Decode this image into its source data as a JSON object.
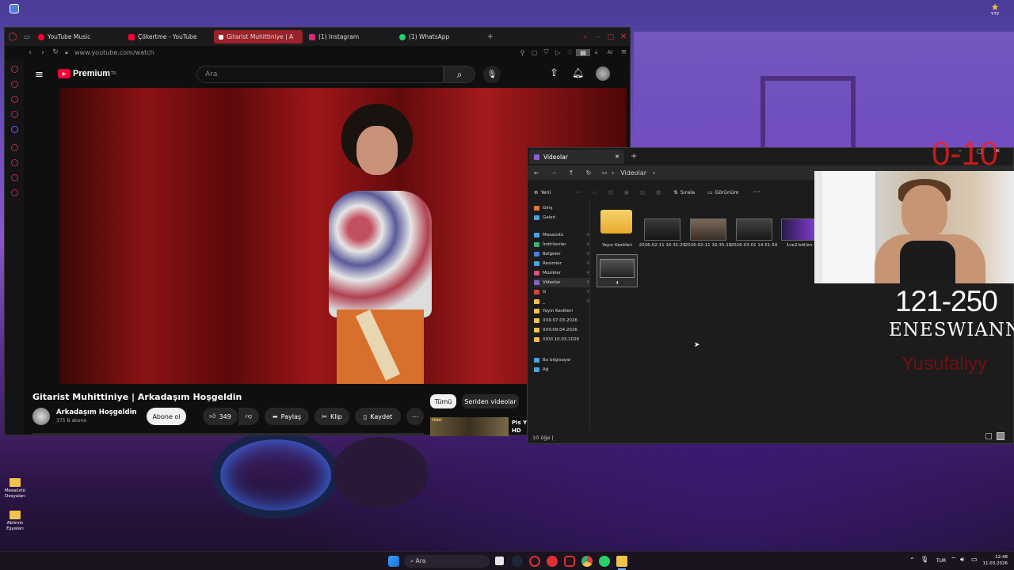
{
  "desktop": {
    "top_left_icon": "app-icon",
    "top_right_label": "Y-TV",
    "icons": [
      {
        "label": "Masaüstü Dosyaları"
      },
      {
        "label": "Ablimin Eşyaları"
      }
    ]
  },
  "browser": {
    "tabs": [
      {
        "label": "YouTube Music",
        "color": "#ff0033"
      },
      {
        "label": "Çökertme - YouTube",
        "color": "#ff0033"
      },
      {
        "label": "Gitarist Muhittiniye | A",
        "color": "#ffffff",
        "active": true
      },
      {
        "label": "(1) Instagram",
        "color": "#d62976"
      },
      {
        "label": "(1) WhatsApp",
        "color": "#25d366"
      }
    ],
    "url": "www.youtube.com/watch",
    "ai_label": "AI"
  },
  "youtube": {
    "logo_text": "Premium",
    "region": "TR",
    "search_placeholder": "Ara",
    "video_title": "Gitarist Muhittiniye | Arkadaşım Hoşgeldin",
    "channel_name": "Arkadaşım Hoşgeldin",
    "subscribers": "375 B abone",
    "subscribe_label": "Abone ol",
    "likes": "349",
    "share_label": "Paylaş",
    "clip_label": "Klip",
    "save_label": "Kaydet",
    "chips": [
      "Tümü",
      "Seriden videolar"
    ],
    "rec_title": "Pis Y HD",
    "rec_badge": "YERLİ"
  },
  "explorer": {
    "tab_title": "Videolar",
    "breadcrumb": "Videolar",
    "new_label": "Yeni",
    "sort_label": "Sırala",
    "view_label": "Görünüm",
    "sidebar": [
      {
        "label": "Giriş",
        "color": "#e07a3a"
      },
      {
        "label": "Galeri",
        "color": "#4aa3df"
      },
      {
        "label": "Masaüstü",
        "color": "#4aa3df"
      },
      {
        "label": "İndirilenler",
        "color": "#3bb273"
      },
      {
        "label": "Belgeler",
        "color": "#4a7fdf"
      },
      {
        "label": "Resimler",
        "color": "#4aa3df"
      },
      {
        "label": "Müzikler",
        "color": "#e0507a"
      },
      {
        "label": "Videolar",
        "color": "#8a5fd0"
      },
      {
        "label": "G",
        "color": "#e04040"
      },
      {
        "label": "_",
        "color": "#f2c14e"
      },
      {
        "label": "Yayın Kesitleri",
        "color": "#f2c14e"
      },
      {
        "label": "XXII.07.03.2026",
        "color": "#f2c14e"
      },
      {
        "label": "XXV.09.04.2026",
        "color": "#f2c14e"
      },
      {
        "label": "XXVI.10.03.2026",
        "color": "#f2c14e"
      },
      {
        "label": "Bu bilgisayar",
        "color": "#4aa3df"
      },
      {
        "label": "Ağ",
        "color": "#4aa3df"
      }
    ],
    "items": [
      {
        "label": "Yayın Kesitleri"
      },
      {
        "label": "2026-02-11 16-31-29"
      },
      {
        "label": "2026-02-11 16-35-18"
      },
      {
        "label": "2026-03-01 14-51-50"
      },
      {
        "label": "1ve2.bölüm"
      },
      {
        "label": "4"
      }
    ],
    "status": "10 öğe"
  },
  "overlay": {
    "score": "0-10",
    "range": "121-250",
    "name": "ENESWIANN",
    "sub_name": "Yusufaliyy",
    "score_color": "#ff1a1a",
    "sub_color": "#8a0c12"
  },
  "taskbar": {
    "search_label": "Ara",
    "lang": "TUR",
    "time": "12:48",
    "date": "11.03.2026"
  }
}
